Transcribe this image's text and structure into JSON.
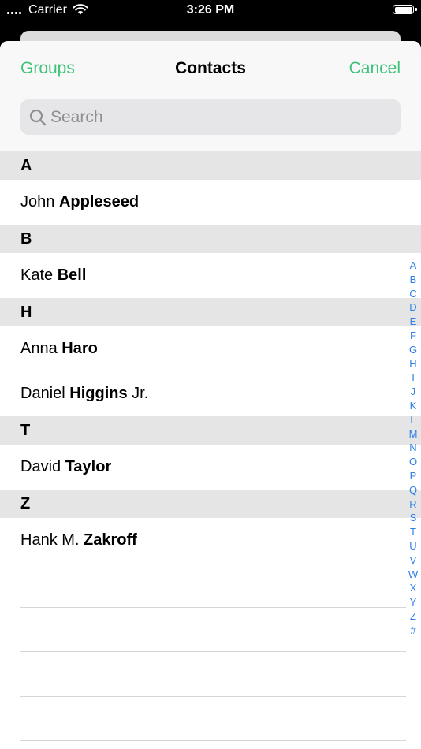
{
  "status_bar": {
    "carrier": "Carrier",
    "time": "3:26 PM"
  },
  "nav": {
    "left_button": "Groups",
    "title": "Contacts",
    "right_button": "Cancel"
  },
  "search": {
    "placeholder": "Search",
    "value": ""
  },
  "colors": {
    "accent": "#3fc27a",
    "index": "#2f80e6",
    "section_bg": "#e5e5e5"
  },
  "sections": [
    {
      "letter": "A",
      "contacts": [
        {
          "given": "John",
          "family": "Appleseed",
          "suffix": ""
        }
      ]
    },
    {
      "letter": "B",
      "contacts": [
        {
          "given": "Kate",
          "family": "Bell",
          "suffix": ""
        }
      ]
    },
    {
      "letter": "H",
      "contacts": [
        {
          "given": "Anna",
          "family": "Haro",
          "suffix": ""
        },
        {
          "given": "Daniel",
          "family": "Higgins",
          "suffix": "Jr."
        }
      ]
    },
    {
      "letter": "T",
      "contacts": [
        {
          "given": "David",
          "family": "Taylor",
          "suffix": ""
        }
      ]
    },
    {
      "letter": "Z",
      "contacts": [
        {
          "given": "Hank M.",
          "family": "Zakroff",
          "suffix": ""
        }
      ]
    }
  ],
  "index_letters": [
    "A",
    "B",
    "C",
    "D",
    "E",
    "F",
    "G",
    "H",
    "I",
    "J",
    "K",
    "L",
    "M",
    "N",
    "O",
    "P",
    "Q",
    "R",
    "S",
    "T",
    "U",
    "V",
    "W",
    "X",
    "Y",
    "Z",
    "#"
  ]
}
